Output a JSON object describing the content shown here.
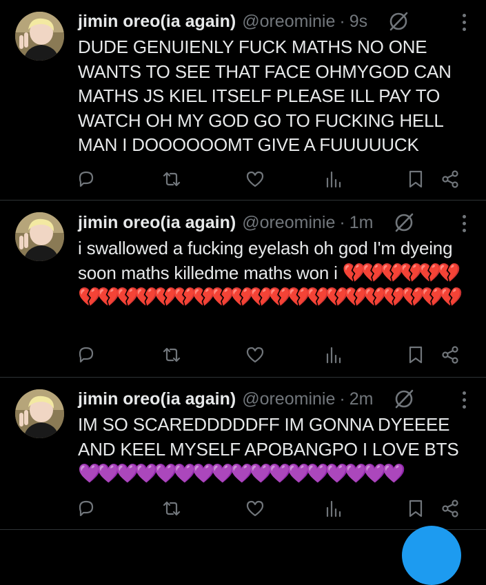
{
  "tweets": [
    {
      "name": "jimin oreo(ia again)",
      "handle": "@oreominie",
      "separator": "·",
      "time": "9s",
      "text": "DUDE GENUIENLY FUCK MATHS NO ONE WANTS TO SEE THAT FACE OHMYGOD CAN MATHS JS KIEL ITSELF PLEASE ILL PAY TO WATCH OH MY GOD GO TO FUCKING HELL MAN I DOOOOOOMT GIVE A FUUUUUCK",
      "emoji": ""
    },
    {
      "name": "jimin oreo(ia again)",
      "handle": "@oreominie",
      "separator": "·",
      "time": "1m",
      "text": "i swallowed a fucking eyelash oh god I'm dyeing soon maths killedme maths won i",
      "emoji": "💔💔💔💔💔💔💔💔💔💔💔💔💔💔💔💔💔💔💔💔💔💔💔💔💔💔"
    },
    {
      "name": "jimin oreo(ia again)",
      "handle": "@oreominie",
      "separator": "·",
      "time": "2m",
      "text": "IM SO SCAREDDDDDFF IM GONNA DYEEEE AND KEEL MYSELF APOBANGPO I LOVE BTS",
      "emoji": "💜💜💜💜💜💜💜💜💜💜💜💜💜💜💜💜💜"
    }
  ],
  "icons": [
    "reply-icon",
    "retweet-icon",
    "like-icon",
    "views-icon",
    "bookmark-icon",
    "share-icon",
    "grok-icon",
    "more-icon"
  ],
  "colors": {
    "background": "#000000",
    "text": "#e7e9ea",
    "muted": "#71767b",
    "divider": "#2f3336",
    "accent": "#1d9bf0"
  }
}
